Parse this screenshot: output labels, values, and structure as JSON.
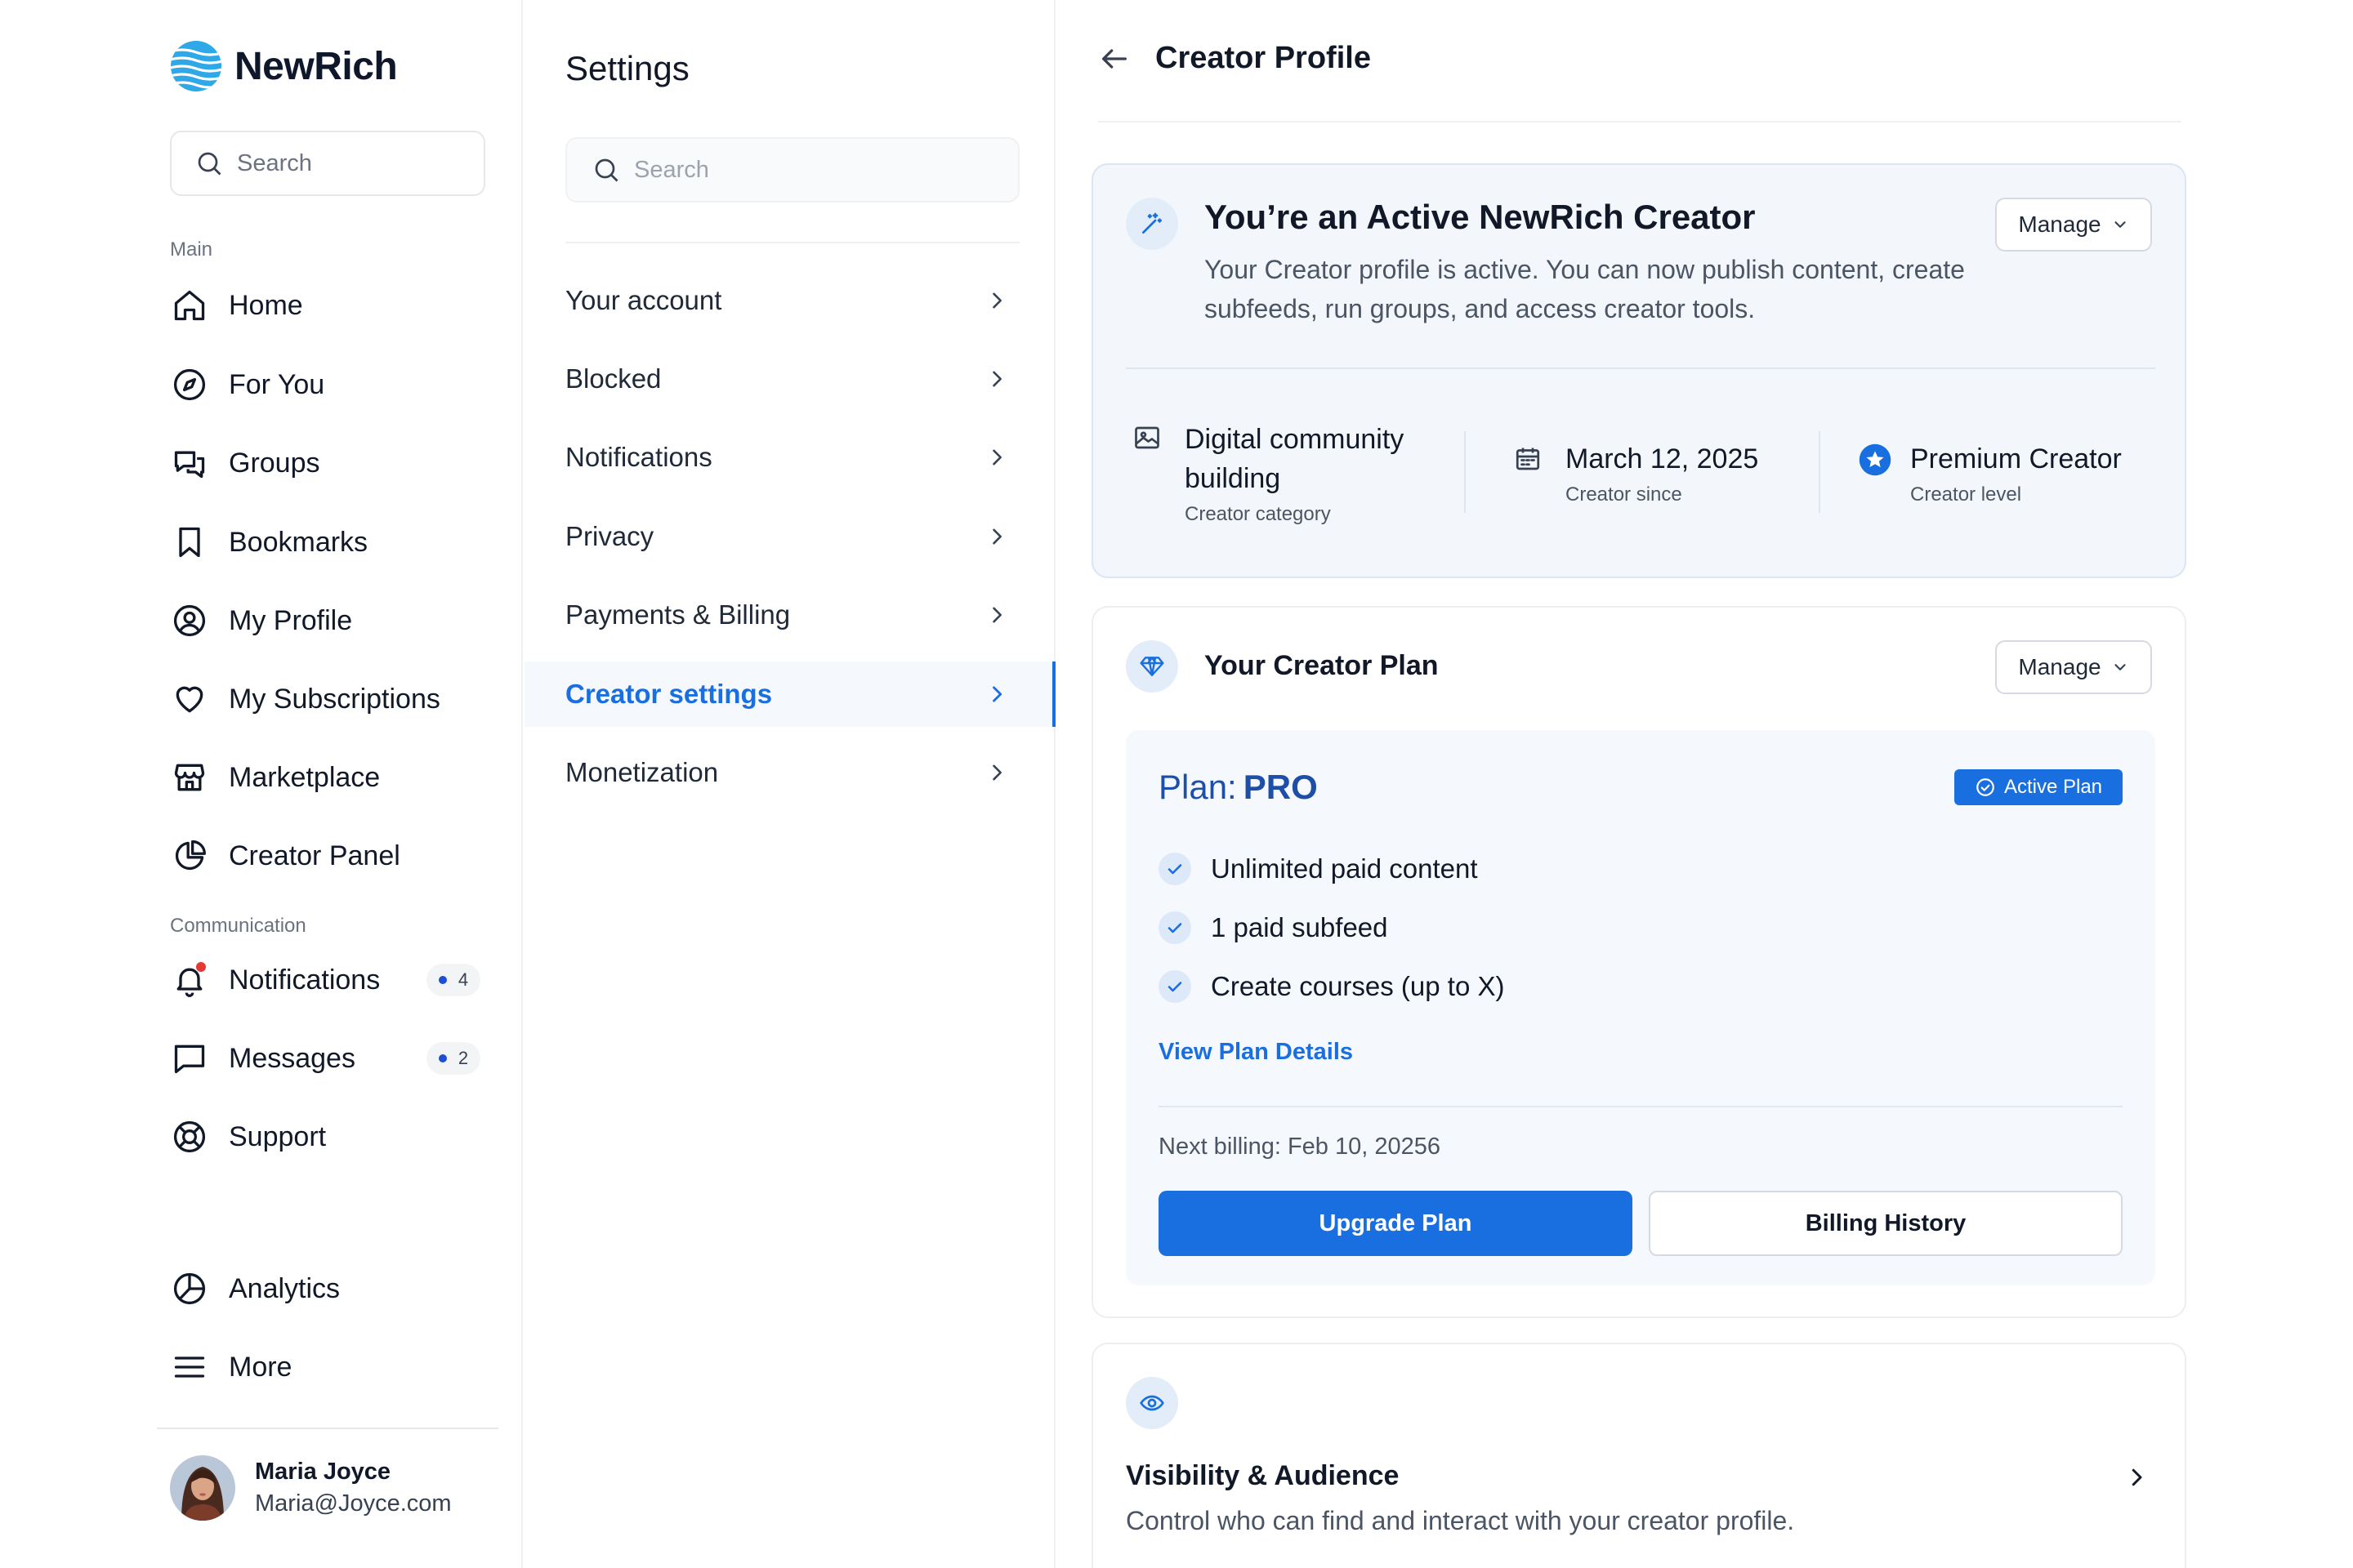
{
  "brand": {
    "name": "NewRich",
    "logo_icon": "globe-stripes-icon",
    "color": "#2ea8e6"
  },
  "sidebar": {
    "search_placeholder": "Search",
    "section_main": "Main",
    "section_communication": "Communication",
    "items": [
      {
        "label": "Home",
        "icon": "home-icon"
      },
      {
        "label": "For You",
        "icon": "compass-icon"
      },
      {
        "label": "Groups",
        "icon": "chat-bubbles-icon"
      },
      {
        "label": "Bookmarks",
        "icon": "bookmark-icon"
      },
      {
        "label": "My Profile",
        "icon": "user-circle-icon"
      },
      {
        "label": "My Subscriptions",
        "icon": "heart-icon"
      },
      {
        "label": "Marketplace",
        "icon": "store-icon"
      },
      {
        "label": "Creator Panel",
        "icon": "pie-chart-icon"
      }
    ],
    "comm_items": [
      {
        "label": "Notifications",
        "icon": "bell-icon",
        "count": "4"
      },
      {
        "label": "Messages",
        "icon": "message-icon",
        "count": "2"
      },
      {
        "label": "Support",
        "icon": "lifebuoy-icon"
      }
    ],
    "bottom_items": [
      {
        "label": "Analytics",
        "icon": "analytics-icon"
      },
      {
        "label": "More",
        "icon": "menu-icon"
      }
    ],
    "user": {
      "name": "Maria Joyce",
      "email": "Maria@Joyce.com"
    }
  },
  "settings": {
    "title": "Settings",
    "search_placeholder": "Search",
    "items": [
      {
        "label": "Your account"
      },
      {
        "label": "Blocked"
      },
      {
        "label": "Notifications"
      },
      {
        "label": "Privacy"
      },
      {
        "label": "Payments & Billing"
      },
      {
        "label": "Creator settings",
        "active": true
      },
      {
        "label": "Monetization"
      }
    ]
  },
  "main": {
    "title": "Creator Profile",
    "active_card": {
      "title": "You’re an Active NewRich Creator",
      "description": "Your Creator profile is active. You can now publish content, create subfeeds, run groups, and access creator tools.",
      "manage_label": "Manage",
      "stats": [
        {
          "value": "Digital community building",
          "label": "Creator category",
          "icon": "image-icon"
        },
        {
          "value": "March 12, 2025",
          "label": "Creator since",
          "icon": "calendar-icon"
        },
        {
          "value": "Premium Creator",
          "label": "Creator level",
          "icon": "star-badge-icon"
        }
      ]
    },
    "plan_card": {
      "title": "Your Creator Plan",
      "manage_label": "Manage",
      "plan_prefix": "Plan:",
      "plan_name": "PRO",
      "badge": "Active Plan",
      "features": [
        "Unlimited paid content",
        "1 paid subfeed",
        "Create courses (up to X)"
      ],
      "view_details": "View Plan Details",
      "next_billing": "Next billing: Feb 10, 20256",
      "upgrade_label": "Upgrade Plan",
      "billing_label": "Billing History"
    },
    "visibility_card": {
      "title": "Visibility & Audience",
      "description": "Control who can find and interact with your creator profile."
    }
  },
  "colors": {
    "accent": "#1a6fe0",
    "active_bg": "#f3f7fc",
    "notification_dot": "#e53935"
  }
}
